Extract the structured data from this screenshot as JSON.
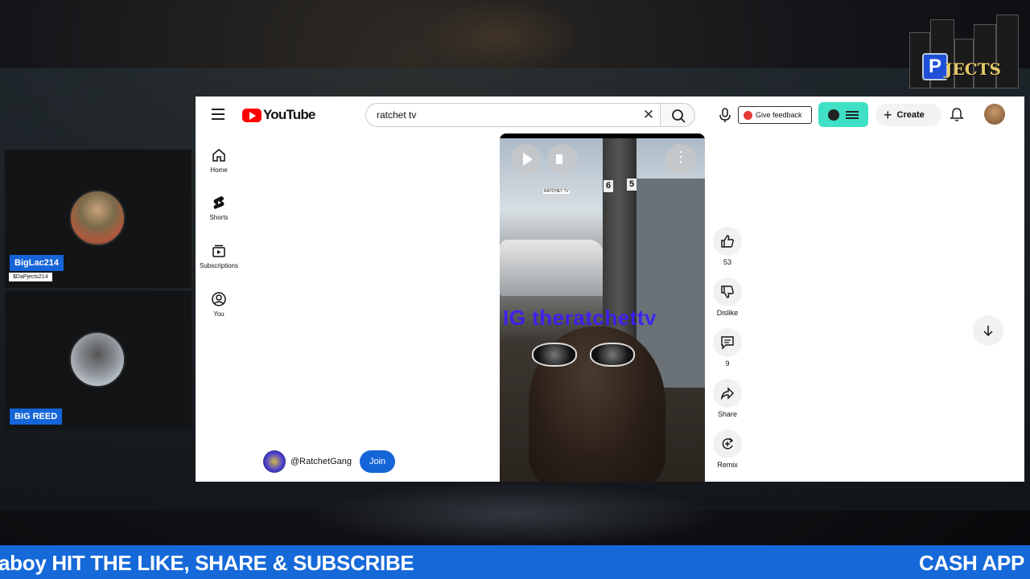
{
  "stream": {
    "brand_logo_text": "DaPJECTS",
    "ticker": {
      "left_text": "aboy HIT THE LIKE, SHARE & SUBSCRIBE",
      "right_text": "CASH APP S"
    },
    "guests": [
      {
        "name": "BigLac214",
        "subtitle": "$DaPjects214"
      },
      {
        "name": "BIG REED"
      }
    ]
  },
  "youtube": {
    "logo_text": "YouTube",
    "search": {
      "value": "ratchet tv",
      "placeholder": "Search"
    },
    "feedback_label": "Give feedback",
    "create_label": "Create",
    "nav": [
      {
        "label": "Home",
        "icon": "home-icon"
      },
      {
        "label": "Shorts",
        "icon": "shorts-icon"
      },
      {
        "label": "Subscriptions",
        "icon": "subscriptions-icon"
      },
      {
        "label": "You",
        "icon": "you-icon"
      }
    ],
    "video": {
      "watermark": "IG theratchettv",
      "sign_numbers": [
        "6",
        "5"
      ],
      "tiny_label": "RATCHET TV"
    },
    "actions": {
      "like_count": "53",
      "dislike_label": "Dislike",
      "comment_count": "9",
      "share_label": "Share",
      "remix_label": "Remix"
    },
    "channel": {
      "handle": "@RatchetGang",
      "join_label": "Join"
    }
  },
  "colors": {
    "youtube_red": "#ff0000",
    "ticker_blue": "#1669d8",
    "name_tag_blue": "#1565d8",
    "extension_teal": "#3fe0c5",
    "watermark_purple": "#3b1cff"
  }
}
